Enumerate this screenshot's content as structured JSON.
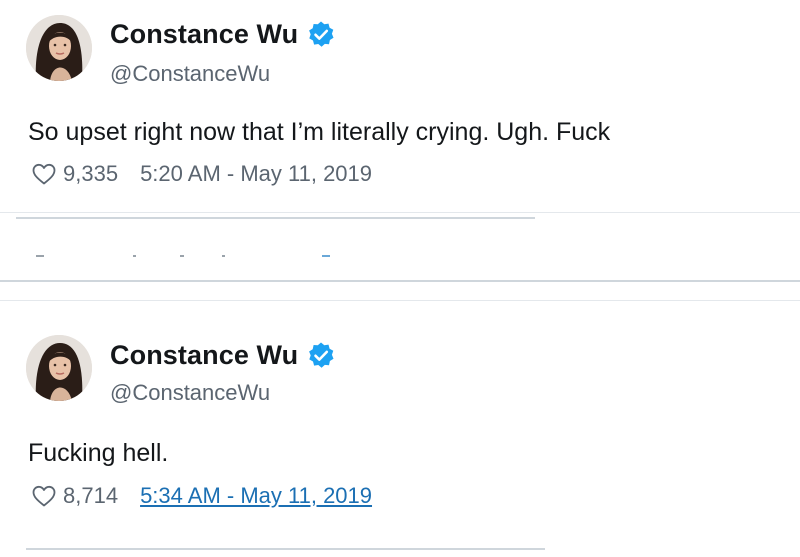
{
  "tweets": [
    {
      "display_name": "Constance Wu",
      "handle": "@ConstanceWu",
      "text": "So upset right now that I’m literally crying. Ugh. Fuck",
      "likes": "9,335",
      "timestamp": "5:20 AM - May 11, 2019",
      "timestamp_is_link": false
    },
    {
      "display_name": "Constance Wu",
      "handle": "@ConstanceWu",
      "text": "Fucking hell.",
      "likes": "8,714",
      "timestamp": "5:34 AM - May 11, 2019",
      "timestamp_is_link": true
    }
  ],
  "icons": {
    "verified": "verified-badge-icon",
    "like": "heart-outline-icon"
  },
  "colors": {
    "verified_blue": "#1da1f2",
    "text": "#14171a",
    "secondary_text": "#5b6570",
    "link": "#1b6fb3"
  }
}
